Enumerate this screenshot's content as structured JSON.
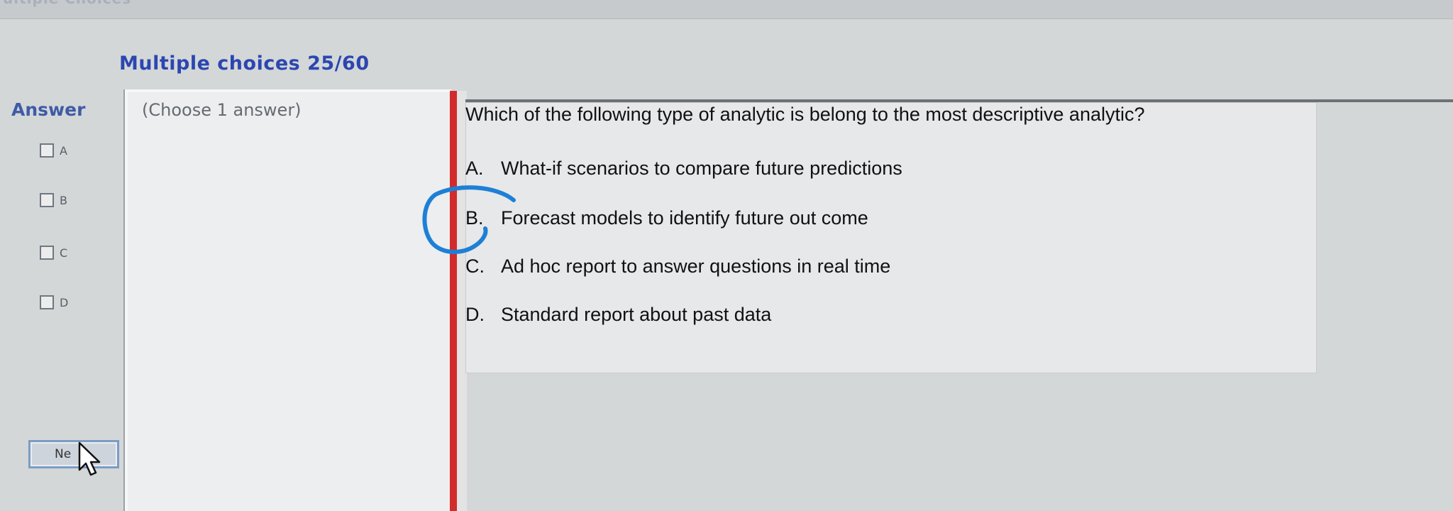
{
  "window": {
    "top_title": "ultiple Choices"
  },
  "header": {
    "title": "Multiple choices 25/60"
  },
  "answer_panel": {
    "label": "Answer",
    "options": [
      {
        "letter": "A"
      },
      {
        "letter": "B"
      },
      {
        "letter": "C"
      },
      {
        "letter": "D"
      }
    ],
    "next_button_label": "Ne"
  },
  "instruction": {
    "text": "(Choose 1 answer)"
  },
  "question": {
    "text": "Which of the following type of analytic is belong to the most descriptive analytic?",
    "choices": [
      {
        "letter": "A.",
        "text": "What-if scenarios to compare future predictions"
      },
      {
        "letter": "B.",
        "text": "Forecast models to identify future out come"
      },
      {
        "letter": "C.",
        "text": "Ad hoc report to answer questions  in real time"
      },
      {
        "letter": "D.",
        "text": "Standard report  about past data"
      }
    ]
  },
  "colors": {
    "header_blue": "#2c46b0",
    "answer_label_blue": "#3f5ba6",
    "divider_red": "#d12b2b",
    "annotation_blue": "#1e7fd6"
  },
  "icons": {
    "cursor": "arrow-cursor-icon",
    "annotation": "hand-drawn-circle"
  }
}
